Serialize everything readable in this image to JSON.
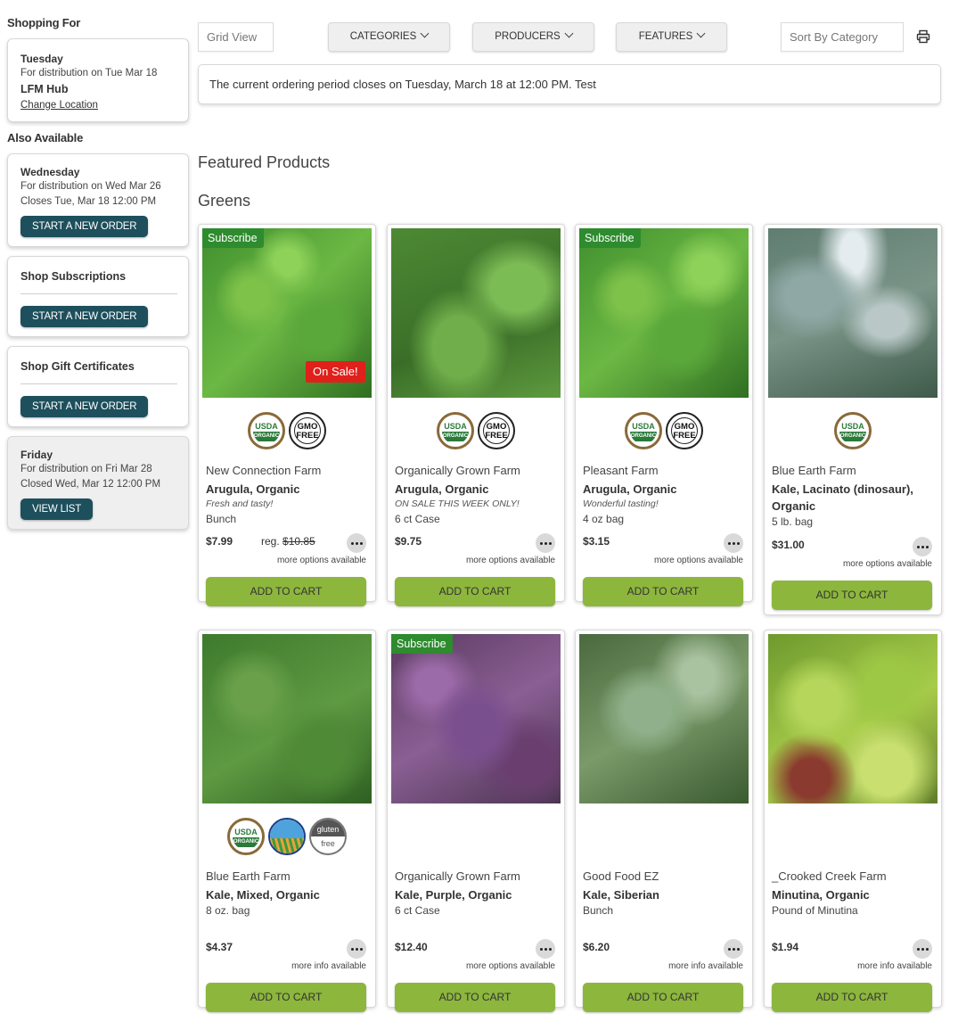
{
  "sidebar": {
    "shopping_for_heading": "Shopping For",
    "current": {
      "day": "Tuesday",
      "distribution": "For distribution on Tue Mar 18",
      "hub": "LFM Hub",
      "change_link": "Change Location"
    },
    "also_available_heading": "Also Available",
    "wednesday": {
      "day": "Wednesday",
      "distribution": "For distribution on Wed Mar 26",
      "closes": "Closes Tue, Mar 18 12:00 PM",
      "button": "START A NEW ORDER"
    },
    "subscriptions": {
      "title": "Shop Subscriptions",
      "button": "START A NEW ORDER"
    },
    "gift": {
      "title": "Shop Gift Certificates",
      "button": "START A NEW ORDER"
    },
    "friday": {
      "day": "Friday",
      "distribution": "For distribution on Fri Mar 28",
      "closed": "Closed Wed, Mar 12 12:00 PM",
      "button": "VIEW LIST"
    }
  },
  "toolbar": {
    "view": "Grid View",
    "categories": "CATEGORIES",
    "producers": "PRODUCERS",
    "features": "FEATURES",
    "sort": "Sort By Category",
    "print_icon": "printer-icon"
  },
  "notice": "The current ordering period closes on Tuesday, March 18 at 12:00 PM. Test",
  "headings": {
    "featured": "Featured Products",
    "category": "Greens"
  },
  "cert_labels": {
    "usda_top": "USDA",
    "usda_band": "ORGANIC",
    "gmo": "GMO FREE",
    "gf_top": "gluten",
    "gf_bottom": "free"
  },
  "colors": {
    "accent_dark": "#1d4f5c",
    "add_to_cart": "#8db63d",
    "subscribe_badge": "#2e8b2e",
    "sale_badge": "#e0201b"
  },
  "products": [
    {
      "farm": "New Connection Farm",
      "name": "Arugula, Organic",
      "note": "Fresh and tasty!",
      "unit": "Bunch",
      "price": "$7.99",
      "reg_label": "reg.",
      "reg_price": "$10.85",
      "more": "more options available",
      "cart": "ADD TO CART",
      "subscribe": "Subscribe",
      "sale": "On Sale!",
      "certs": [
        "usda",
        "gmo"
      ]
    },
    {
      "farm": "Organically Grown Farm",
      "name": "Arugula, Organic",
      "note": "ON SALE THIS WEEK ONLY!",
      "unit": "6 ct Case",
      "price": "$9.75",
      "more": "more options available",
      "cart": "ADD TO CART",
      "certs": [
        "usda",
        "gmo"
      ]
    },
    {
      "farm": "Pleasant Farm",
      "name": "Arugula, Organic",
      "note": "Wonderful tasting!",
      "unit": "4 oz bag",
      "price": "$3.15",
      "more": "more options available",
      "cart": "ADD TO CART",
      "subscribe": "Subscribe",
      "certs": [
        "usda",
        "gmo"
      ]
    },
    {
      "farm": "Blue Earth Farm",
      "name": "Kale, Lacinato (dinosaur), Organic",
      "unit": "5 lb. bag",
      "price": "$31.00",
      "more": "more options available",
      "cart": "ADD TO CART",
      "certs": [
        "usda"
      ]
    },
    {
      "farm": "Blue Earth Farm",
      "name": "Kale, Mixed, Organic",
      "unit": "8 oz. bag",
      "price": "$4.37",
      "more": "more info available",
      "cart": "ADD TO CART",
      "certs": [
        "usda",
        "naturally",
        "gluten"
      ]
    },
    {
      "farm": "Organically Grown Farm",
      "name": "Kale, Purple, Organic",
      "unit": "6 ct Case",
      "price": "$12.40",
      "more": "more options available",
      "cart": "ADD TO CART",
      "subscribe": "Subscribe",
      "certs": []
    },
    {
      "farm": "Good Food EZ",
      "name": "Kale, Siberian",
      "unit": "Bunch",
      "price": "$6.20",
      "more": "more info available",
      "cart": "ADD TO CART",
      "certs": []
    },
    {
      "farm": "_Crooked Creek Farm",
      "name": "Minutina, Organic",
      "unit": "Pound of Minutina",
      "price": "$1.94",
      "more": "more info available",
      "cart": "ADD TO CART",
      "certs": []
    }
  ]
}
